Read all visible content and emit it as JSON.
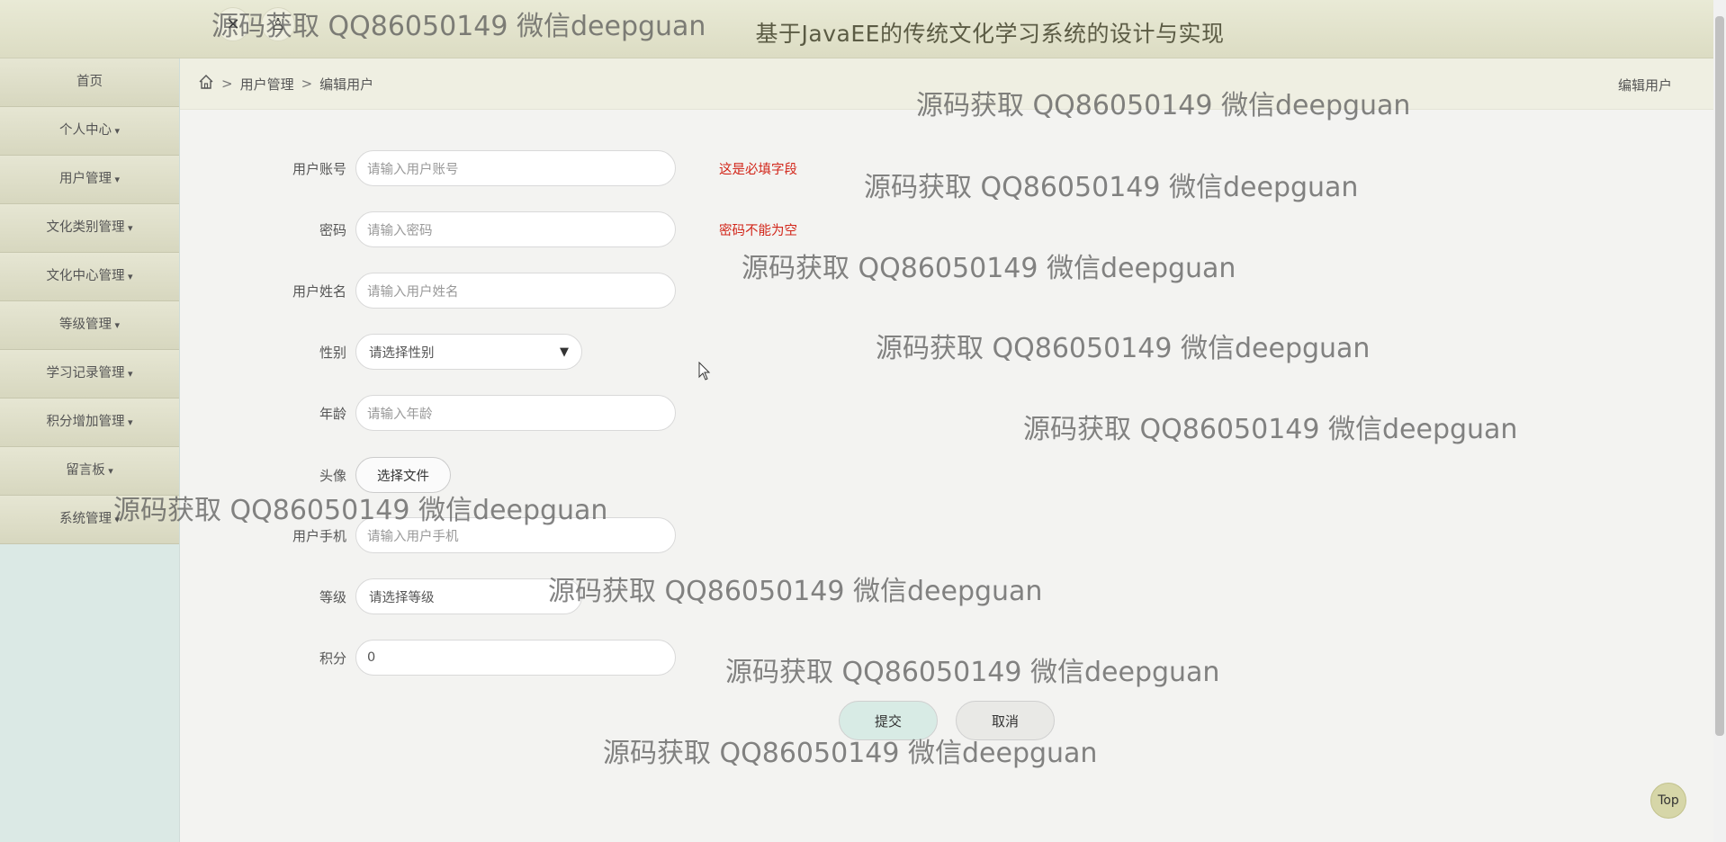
{
  "app_title": "基于JavaEE的传统文化学习系统的设计与实现",
  "header": {
    "icons": [
      "close-x-icon",
      "user-icon"
    ]
  },
  "sidebar": {
    "items": [
      {
        "label": "首页"
      },
      {
        "label": "个人中心"
      },
      {
        "label": "用户管理"
      },
      {
        "label": "文化类别管理"
      },
      {
        "label": "文化中心管理"
      },
      {
        "label": "等级管理"
      },
      {
        "label": "学习记录管理"
      },
      {
        "label": "积分增加管理"
      },
      {
        "label": "留言板"
      },
      {
        "label": "系统管理"
      }
    ]
  },
  "breadcrumb": {
    "sep": ">",
    "level1": "用户管理",
    "level2": "编辑用户",
    "right": "编辑用户"
  },
  "form": {
    "account": {
      "label": "用户账号",
      "placeholder": "请输入用户账号",
      "error": "这是必填字段"
    },
    "password": {
      "label": "密码",
      "placeholder": "请输入密码",
      "error": "密码不能为空"
    },
    "name": {
      "label": "用户姓名",
      "placeholder": "请输入用户姓名"
    },
    "gender": {
      "label": "性别",
      "selected": "请选择性别"
    },
    "age": {
      "label": "年龄",
      "placeholder": "请输入年龄"
    },
    "avatar": {
      "label": "头像",
      "button": "选择文件"
    },
    "phone": {
      "label": "用户手机",
      "placeholder": "请输入用户手机"
    },
    "level": {
      "label": "等级",
      "selected": "请选择等级"
    },
    "points": {
      "label": "积分",
      "value": "0"
    }
  },
  "buttons": {
    "submit": "提交",
    "cancel": "取消",
    "top": "Top"
  },
  "watermark": "源码获取 QQ86050149 微信deepguan",
  "colors": {
    "error": "#d2261a",
    "header": "#dcdcc3",
    "sidebar": "#dbe9e5",
    "submit": "#d8ebe5"
  }
}
